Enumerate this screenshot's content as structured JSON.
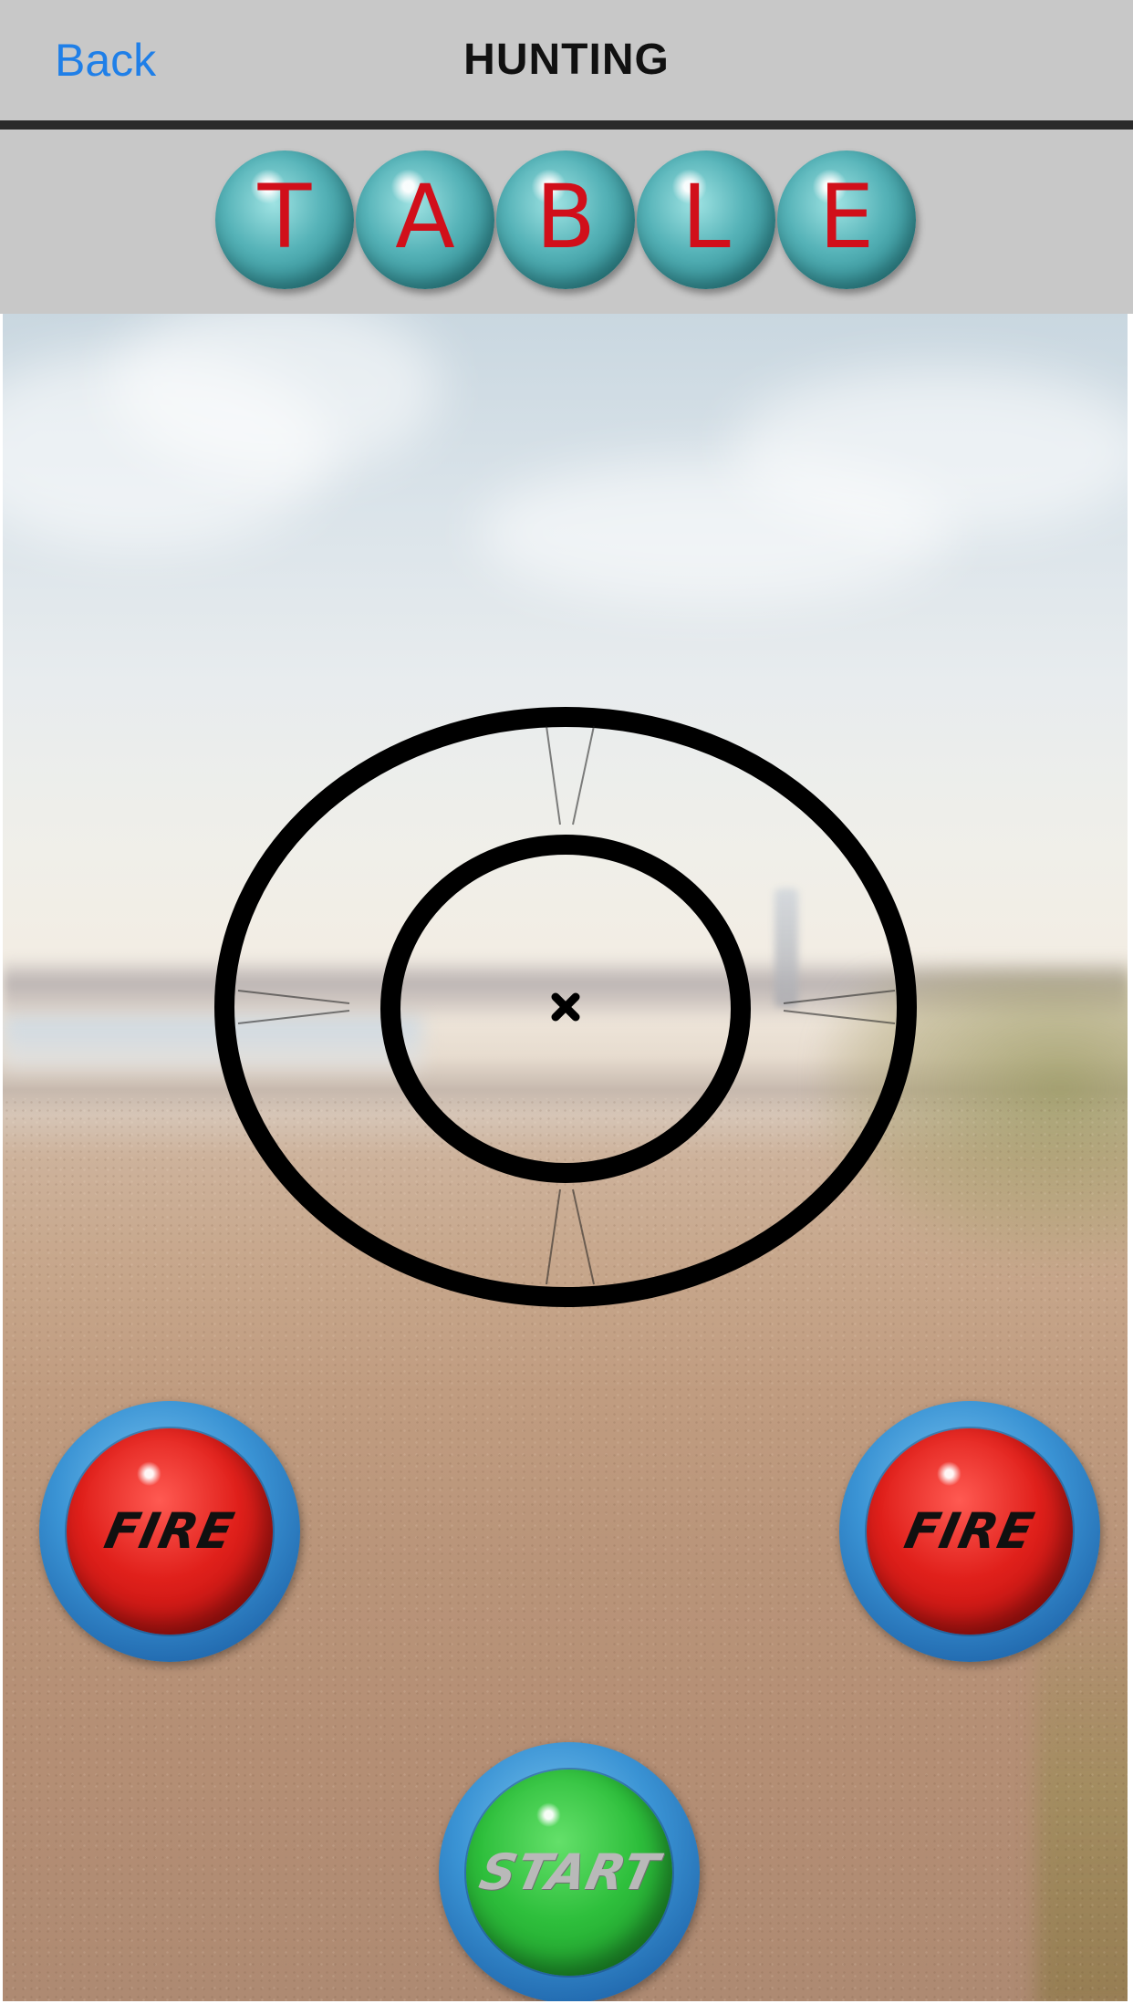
{
  "navbar": {
    "back_label": "Back",
    "title": "HUNTING"
  },
  "word": {
    "letters": [
      "T",
      "A",
      "B",
      "L",
      "E"
    ]
  },
  "controls": {
    "fire_left_label": "FIRE",
    "fire_right_label": "FIRE",
    "start_label": "START"
  },
  "colors": {
    "back_link": "#1f7fe8",
    "letter_ball": "#56b3b8",
    "letter_text": "#d10f1a",
    "fire_button": "#e0201b",
    "start_button": "#2ebf3c",
    "button_ring": "#3a93d4"
  },
  "icons": {
    "crosshair": "crosshair-icon",
    "center_mark": "x-mark-icon"
  }
}
